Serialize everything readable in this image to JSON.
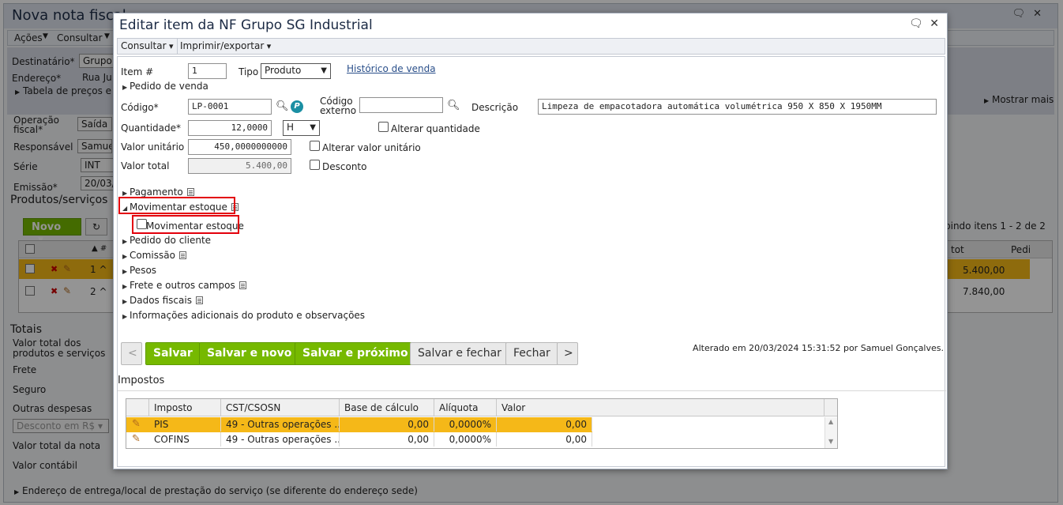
{
  "background": {
    "title": "Nova nota fiscal",
    "menu": [
      "Ações",
      "Consultar"
    ],
    "destinatario_label": "Destinatário*",
    "destinatario_value": "Grupo S",
    "endereco_label": "Endereço*",
    "endereco_value": "Rua Ju",
    "tabela_label": "Tabela de preços e re",
    "mostrar_mais": "Mostrar mais",
    "operacao_label": "Operação fiscal*",
    "operacao_value": "Saída",
    "responsavel_label": "Responsável",
    "responsavel_value": "Samue",
    "serie_label": "Série",
    "serie_value": "INT",
    "emissao_label": "Emissão*",
    "emissao_value": "20/03/2",
    "produtos_title": "Produtos/serviços",
    "novo_label": "Novo",
    "exibindo": "bindo itens 1 - 2 de 2",
    "col_tot": "tot",
    "col_pedi": "Pedi",
    "row1_total": "5.400,00",
    "row2_total": "7.840,00",
    "totais_title": "Totais",
    "valor_total_label": "Valor total dos produtos e serviços",
    "frete_label": "Frete",
    "seguro_label": "Seguro",
    "outras_label": "Outras despesas",
    "desconto_placeholder": "Desconto em R$",
    "valor_nota_label": "Valor total da nota",
    "valor_contabil_label": "Valor contábil",
    "endereco_entrega": "Endereço de entrega/local de prestação do serviço (se diferente do endereço sede)"
  },
  "dialog": {
    "title": "Editar item da NF Grupo SG Industrial",
    "menu": [
      "Consultar",
      "Imprimir/exportar"
    ],
    "item_label": "Item #",
    "item_value": "1",
    "tipo_label": "Tipo",
    "tipo_value": "Produto",
    "historico_link": "Histórico de venda",
    "pedido_venda": "Pedido de venda",
    "codigo_label": "Código*",
    "codigo_value": "LP-0001",
    "codigo_externo_label": "Código externo",
    "descricao_label": "Descrição",
    "descricao_value": "Limpeza de empacotadora automática volumétrica 950 X 850 X 1950MM",
    "quantidade_label": "Quantidade*",
    "quantidade_value": "12,0000",
    "unidade_value": "H",
    "alterar_quantidade": "Alterar quantidade",
    "valor_unitario_label": "Valor unitário",
    "valor_unitario_value": "450,0000000000",
    "alterar_valor_unitario": "Alterar valor unitário",
    "valor_total_label": "Valor total",
    "valor_total_value": "5.400,00",
    "desconto_label": "Desconto",
    "sections": {
      "pagamento": "Pagamento",
      "movimentar_estoque": "Movimentar estoque",
      "movimentar_estoque_checkbox": "Movimentar estoque",
      "pedido_cliente": "Pedido do cliente",
      "comissao": "Comissão",
      "pesos": "Pesos",
      "frete": "Frete e outros campos",
      "dados_fiscais": "Dados fiscais",
      "info_adicionais": "Informações adicionais do produto e observações"
    },
    "buttons": {
      "prev": "<",
      "salvar": "Salvar",
      "salvar_novo": "Salvar e novo",
      "salvar_proximo": "Salvar e próximo",
      "salvar_fechar": "Salvar e fechar",
      "fechar": "Fechar",
      "next": ">"
    },
    "alterado": "Alterado em 20/03/2024 15:31:52 por Samuel Gonçalves.",
    "impostos_title": "Impostos",
    "impostos": {
      "headers": [
        "Imposto",
        "CST/CSOSN",
        "Base de cálculo",
        "Alíquota",
        "Valor"
      ],
      "rows": [
        {
          "imposto": "PIS",
          "cst": "49 - Outras operações ...",
          "base": "0,00",
          "aliquota": "0,0000%",
          "valor": "0,00"
        },
        {
          "imposto": "COFINS",
          "cst": "49 - Outras operações ...",
          "base": "0,00",
          "aliquota": "0,0000%",
          "valor": "0,00"
        }
      ]
    }
  },
  "colors": {
    "green": "#76b900",
    "highlight": "#f5b818",
    "red_outline": "#e3000b"
  }
}
